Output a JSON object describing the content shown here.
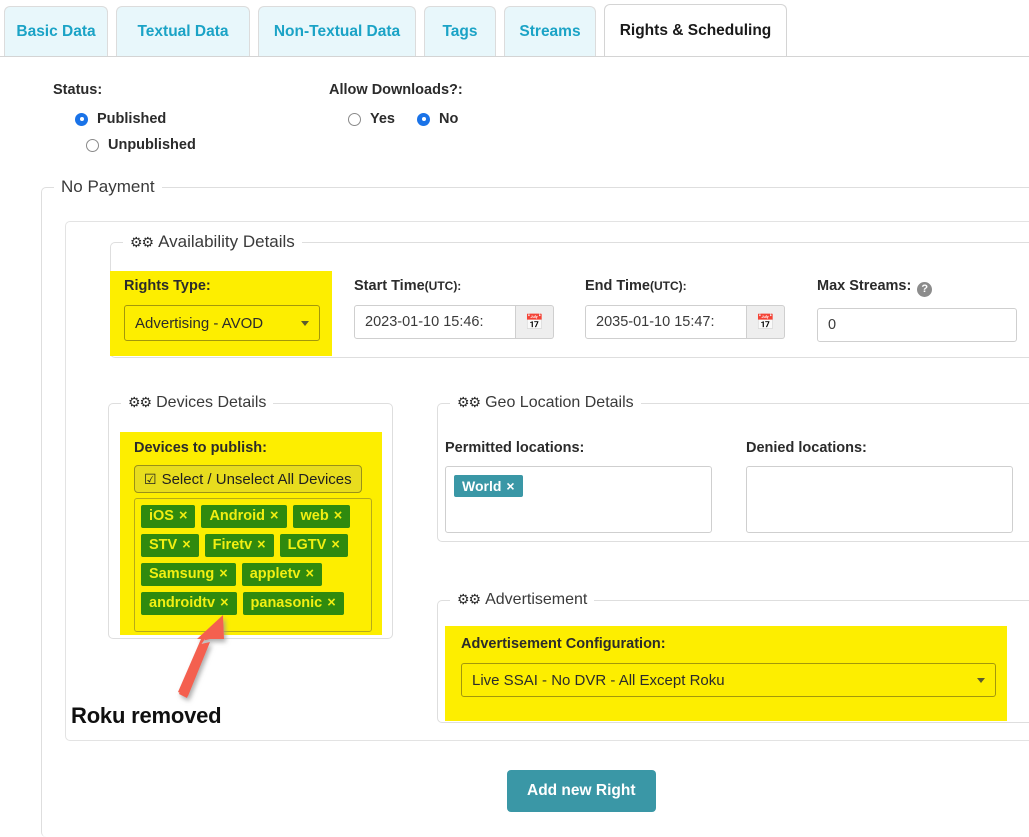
{
  "tabs": [
    {
      "label": "Basic Data",
      "active": false
    },
    {
      "label": "Textual Data",
      "active": false
    },
    {
      "label": "Non-Textual Data",
      "active": false
    },
    {
      "label": "Tags",
      "active": false
    },
    {
      "label": "Streams",
      "active": false
    },
    {
      "label": "Rights & Scheduling",
      "active": true
    }
  ],
  "status": {
    "label": "Status:",
    "options": [
      {
        "label": "Published",
        "selected": true
      },
      {
        "label": "Unpublished",
        "selected": false
      }
    ]
  },
  "downloads": {
    "label": "Allow Downloads?:",
    "options": [
      {
        "label": "Yes",
        "selected": false
      },
      {
        "label": "No",
        "selected": true
      }
    ]
  },
  "payment": {
    "legend": "No Payment"
  },
  "availability": {
    "legend": "Availability Details",
    "rights_type": {
      "label": "Rights Type:",
      "value": "Advertising - AVOD"
    },
    "start_time": {
      "label": "Start Time",
      "unit": "(UTC):",
      "value": "2023-01-10 15:46:"
    },
    "end_time": {
      "label": "End Time",
      "unit": "(UTC):",
      "value": "2035-01-10 15:47:"
    },
    "max_streams": {
      "label": "Max Streams:",
      "value": "0",
      "help": "?"
    }
  },
  "devices": {
    "legend": "Devices Details",
    "label": "Devices to publish:",
    "select_all_label": "Select / Unselect All Devices",
    "select_all_glyph": "☑",
    "chips": [
      "iOS",
      "Android",
      "web",
      "STV",
      "Firetv",
      "LGTV",
      "Samsung",
      "appletv",
      "androidtv",
      "panasonic"
    ],
    "remove_glyph": "×"
  },
  "geo": {
    "legend": "Geo Location Details",
    "permitted": {
      "label": "Permitted locations:",
      "chips": [
        "World"
      ]
    },
    "denied": {
      "label": "Denied locations:",
      "chips": []
    }
  },
  "advertisement": {
    "legend": "Advertisement",
    "config": {
      "label": "Advertisement Configuration:",
      "value": "Live SSAI - No DVR - All Except Roku"
    }
  },
  "footer": {
    "add_right_label": "Add new Right"
  },
  "annotation": {
    "text": "Roku removed",
    "arrow_color": "#f4604f"
  },
  "icons": {
    "cogs": "⚙",
    "calendar": "Ὄ5"
  },
  "colors": {
    "accent_teal": "#3a97a6",
    "tab_text": "#1ba3c6",
    "tab_bg": "#e8f7fb",
    "highlight_yellow": "#fdee00",
    "chip_green": "#2f8a0e",
    "chip_green_text": "#f2ef12",
    "radio_blue": "#1a73e8",
    "annotation_red": "#f4604f"
  }
}
